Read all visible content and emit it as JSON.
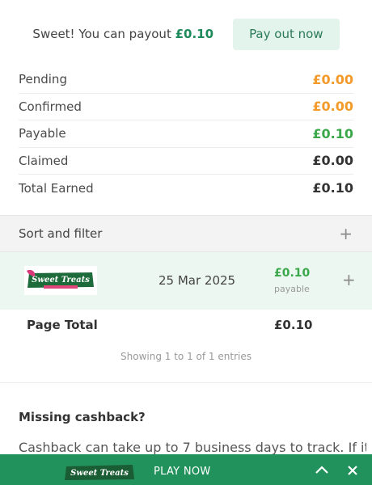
{
  "payout": {
    "prefix": "Sweet! You can payout",
    "amount": "£0.10",
    "button_label": "Pay out now"
  },
  "summary": [
    {
      "label": "Pending",
      "value": "£0.00",
      "color": "#f39a2b"
    },
    {
      "label": "Confirmed",
      "value": "£0.00",
      "color": "#f39a2b"
    },
    {
      "label": "Payable",
      "value": "£0.10",
      "color": "#3aa84a"
    },
    {
      "label": "Claimed",
      "value": "£0.00",
      "color": "#333333"
    },
    {
      "label": "Total Earned",
      "value": "£0.10",
      "color": "#333333"
    }
  ],
  "sort_filter": {
    "label": "Sort and filter",
    "icon": "plus-icon"
  },
  "entry": {
    "logo_text": "Sweet Treats",
    "date": "25 Mar 2025",
    "amount": "£0.10",
    "status": "payable",
    "expand_icon": "plus-icon"
  },
  "page_total": {
    "label": "Page Total",
    "value": "£0.10"
  },
  "showing": "Showing 1 to 1 of 1 entries",
  "missing": {
    "title": "Missing cashback?",
    "text": "Cashback can take up to 7 business days to track. If it"
  },
  "bottom_bar": {
    "logo_text": "Sweet Treats",
    "play_label": "PLAY NOW",
    "expand_icon": "chevron-up-icon",
    "close_icon": "close-icon"
  },
  "colors": {
    "brand_green": "#22925c",
    "pending_orange": "#f39a2b",
    "payable_green": "#3aa84a"
  }
}
